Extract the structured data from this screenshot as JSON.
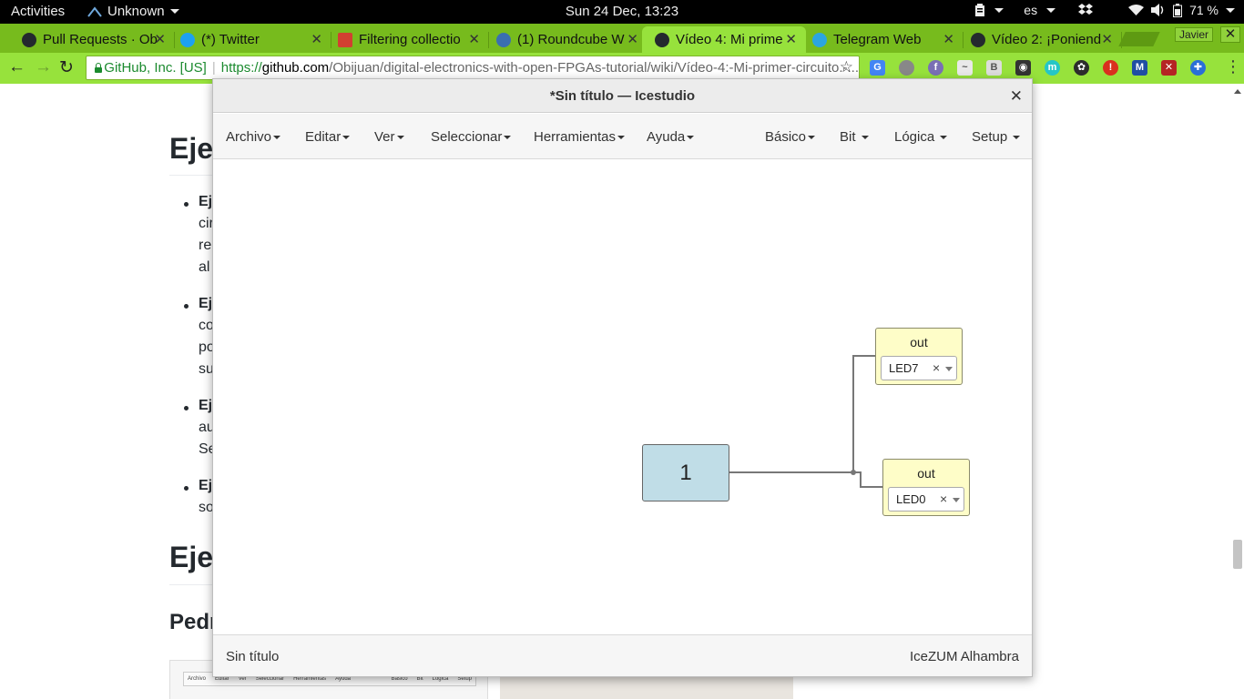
{
  "topbar": {
    "activities": "Activities",
    "app_name": "Unknown",
    "clock": "Sun 24 Dec, 13:23",
    "lang": "es",
    "battery": "71 %"
  },
  "tabs": [
    {
      "title": "Pull Requests · Ob",
      "favicon_color": "#24292e"
    },
    {
      "title": "(*) Twitter",
      "favicon_color": "#1da1f2"
    },
    {
      "title": "Filtering collectio",
      "favicon_color": "#d23f31"
    },
    {
      "title": "(1) Roundcube W",
      "favicon_color": "#3a6fb0"
    },
    {
      "title": "Vídeo 4: Mi prime",
      "favicon_color": "#24292e"
    },
    {
      "title": "Telegram Web",
      "favicon_color": "#2ca5e0"
    },
    {
      "title": "Vídeo 2: ¡Poniend",
      "favicon_color": "#24292e"
    }
  ],
  "profile_name": "Javier",
  "omnibox": {
    "org": "GitHub, Inc. [US]",
    "protocol": "https://",
    "host": "github.com",
    "path": "/Obijuan/digital-electronics-with-open-FPGAs-tutorial/wiki/Vídeo-4:-Mi-primer-circuito.-..."
  },
  "background_page": {
    "heading1": "Eje",
    "heading2": "Eje",
    "heading3": "Pedr",
    "bullets": [
      {
        "lines": [
          "Ej",
          "cir",
          "re",
          "al"
        ]
      },
      {
        "lines": [
          "Ej",
          "co",
          "po",
          "su"
        ]
      },
      {
        "lines": [
          "Ej",
          "au",
          "Se"
        ]
      },
      {
        "lines": [
          "Ej",
          "so"
        ]
      }
    ],
    "thumb_menu": [
      "Archivo",
      "Editar",
      "Ver",
      "Seleccionar",
      "Herramientas",
      "Ayuda",
      "Básico",
      "Bit",
      "Lógica",
      "Setup"
    ]
  },
  "icestudio": {
    "title": "*Sin título — Icestudio",
    "menu_left": [
      "Archivo",
      "Editar",
      "Ver",
      "Seleccionar",
      "Herramientas",
      "Ayuda"
    ],
    "menu_right": [
      "Básico",
      "Bit",
      "Lógica",
      "Setup"
    ],
    "status_left": "Sin título",
    "status_right": "IceZUM Alhambra",
    "constant_value": "1",
    "outputs": [
      {
        "label": "out",
        "pin": "LED7"
      },
      {
        "label": "out",
        "pin": "LED0"
      }
    ]
  }
}
